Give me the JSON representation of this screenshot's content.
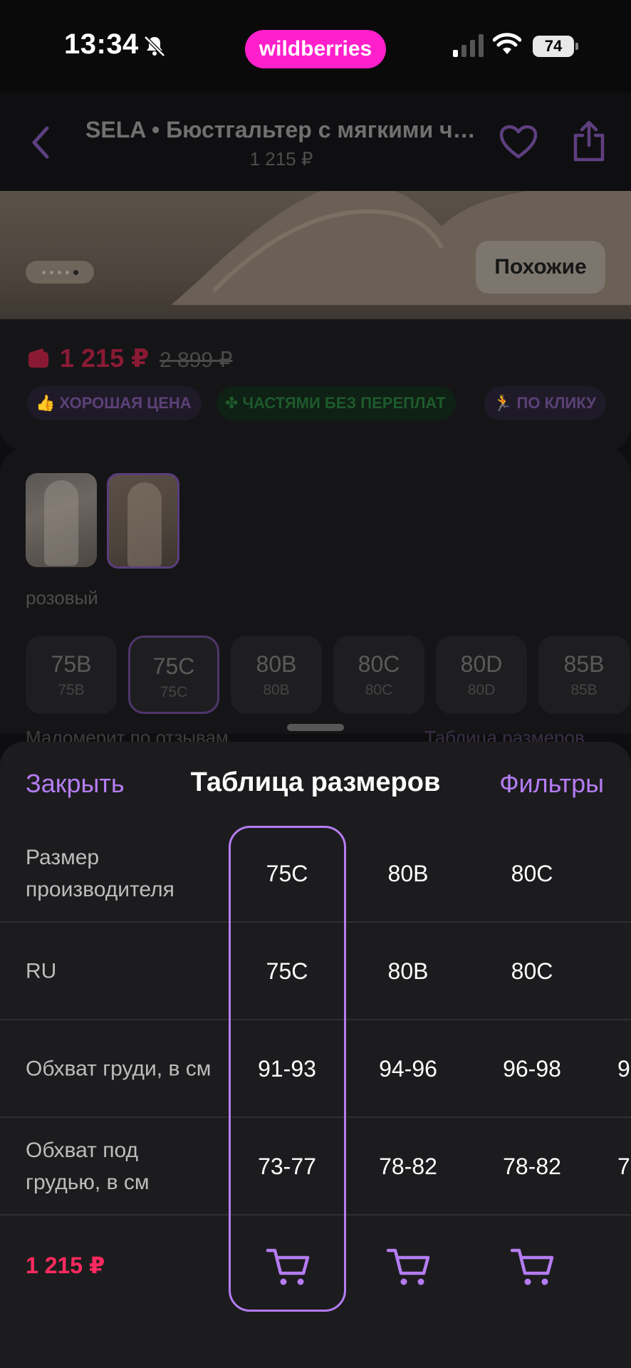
{
  "status_bar": {
    "time": "13:34",
    "brand_pill": "wildberries",
    "battery": "74",
    "icons": [
      "bell-slash-icon",
      "cellular-signal-icon",
      "wifi-icon",
      "battery-icon"
    ]
  },
  "header": {
    "title": "SELA • Бюстгальтер с мягкими чашками",
    "subtitle_price": "1 215 ₽",
    "icons": [
      "chevron-left-icon",
      "heart-icon",
      "share-icon"
    ]
  },
  "gallery": {
    "similar_button": "Похожие",
    "dots_total": 5,
    "dots_active_index": 4
  },
  "price": {
    "current": "1 215 ₽",
    "old": "2 899 ₽",
    "badges": [
      "ХОРОШАЯ ЦЕНА",
      "ЧАСТЯМИ БЕЗ ПЕРЕПЛАТ",
      "ПО КЛИКУ"
    ]
  },
  "colors": {
    "selected_label": "розовый",
    "selected_index": 1
  },
  "sizes": {
    "items": [
      {
        "label": "75B",
        "ru": "75B"
      },
      {
        "label": "75C",
        "ru": "75C"
      },
      {
        "label": "80B",
        "ru": "80B"
      },
      {
        "label": "80C",
        "ru": "80C"
      },
      {
        "label": "80D",
        "ru": "80D"
      },
      {
        "label": "85B",
        "ru": "85B"
      }
    ],
    "selected_index": 1,
    "hint_left": "Маломерит по отзывам",
    "hint_right": "Таблица размеров"
  },
  "sheet": {
    "close": "Закрыть",
    "title": "Таблица размеров",
    "filters": "Фильтры",
    "rows": [
      {
        "label": "Размер производителя",
        "values": [
          "75C",
          "80B",
          "80C",
          ""
        ]
      },
      {
        "label": "RU",
        "values": [
          "75C",
          "80B",
          "80C",
          ""
        ]
      },
      {
        "label": "Обхват груди, в см",
        "values": [
          "91-93",
          "94-96",
          "96-98",
          "9"
        ]
      },
      {
        "label": "Обхват под грудью, в см",
        "values": [
          "73-77",
          "78-82",
          "78-82",
          "7"
        ]
      }
    ],
    "footer_price": "1 215 ₽",
    "cart_icon": "cart-icon",
    "selected_column": 0,
    "accent_color": "#b57cf2",
    "price_color": "#ff2a5f"
  }
}
